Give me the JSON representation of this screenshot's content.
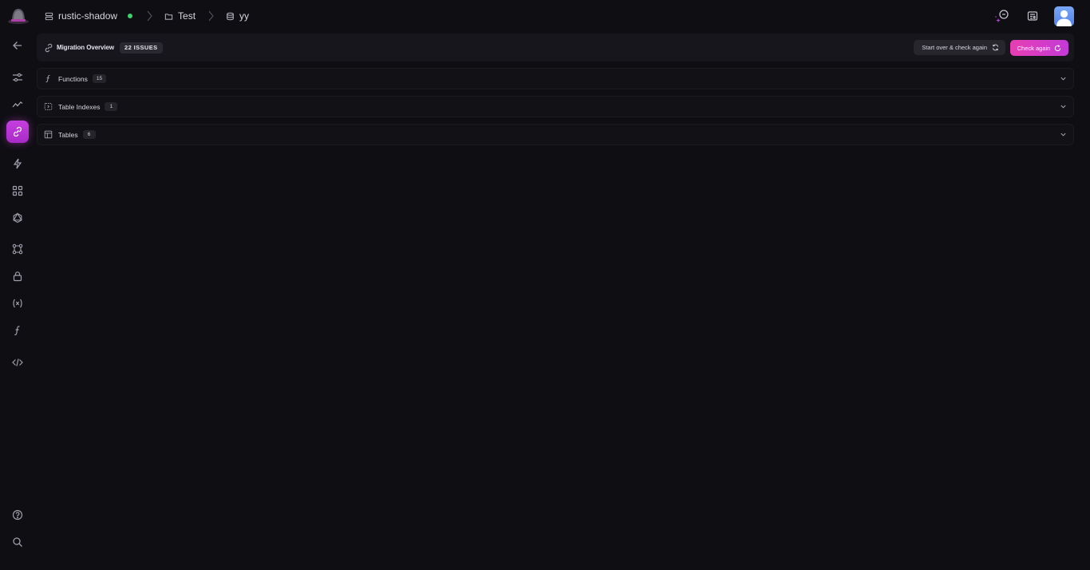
{
  "header": {
    "project": "rustic-shadow",
    "folder": "Test",
    "database": "yy"
  },
  "icons": {
    "project": "server-icon",
    "folder": "folder-icon",
    "database": "database-icon",
    "ai_assistant": "ai-sparkle-icon",
    "news": "newspaper-icon",
    "avatar": "user-avatar"
  },
  "colors": {
    "accent": "#d03ccf",
    "status_online": "#3dd26b",
    "background": "#0f0e13"
  },
  "sidebar": {
    "items": [
      {
        "name": "back",
        "icon": "arrow-left-icon",
        "active": false
      },
      {
        "name": "settings",
        "icon": "sliders-icon",
        "active": false
      },
      {
        "name": "metrics",
        "icon": "activity-icon",
        "active": false
      },
      {
        "name": "migrations",
        "icon": "link-icon",
        "active": true
      },
      {
        "name": "functions-events",
        "icon": "bolt-icon",
        "active": false
      },
      {
        "name": "apps",
        "icon": "grid-icon",
        "active": false
      },
      {
        "name": "graphql",
        "icon": "graphql-icon",
        "active": false
      },
      {
        "name": "schema",
        "icon": "schema-icon",
        "active": false
      },
      {
        "name": "access",
        "icon": "lock-icon",
        "active": false
      },
      {
        "name": "variables",
        "icon": "variable-icon",
        "active": false
      },
      {
        "name": "functions",
        "icon": "function-icon",
        "active": false
      },
      {
        "name": "api-docs",
        "icon": "code-icon",
        "active": false
      },
      {
        "name": "help",
        "icon": "help-circle-icon",
        "active": false
      },
      {
        "name": "search",
        "icon": "search-icon",
        "active": false
      }
    ]
  },
  "overview": {
    "title": "Migration Overview",
    "issues_badge": "22 ISSUES",
    "start_over_label": "Start over & check again",
    "check_again_label": "Check again"
  },
  "sections": [
    {
      "label": "Functions",
      "count": "15",
      "icon": "function-icon"
    },
    {
      "label": "Table Indexes",
      "count": "1",
      "icon": "index-icon"
    },
    {
      "label": "Tables",
      "count": "6",
      "icon": "table-icon"
    }
  ]
}
